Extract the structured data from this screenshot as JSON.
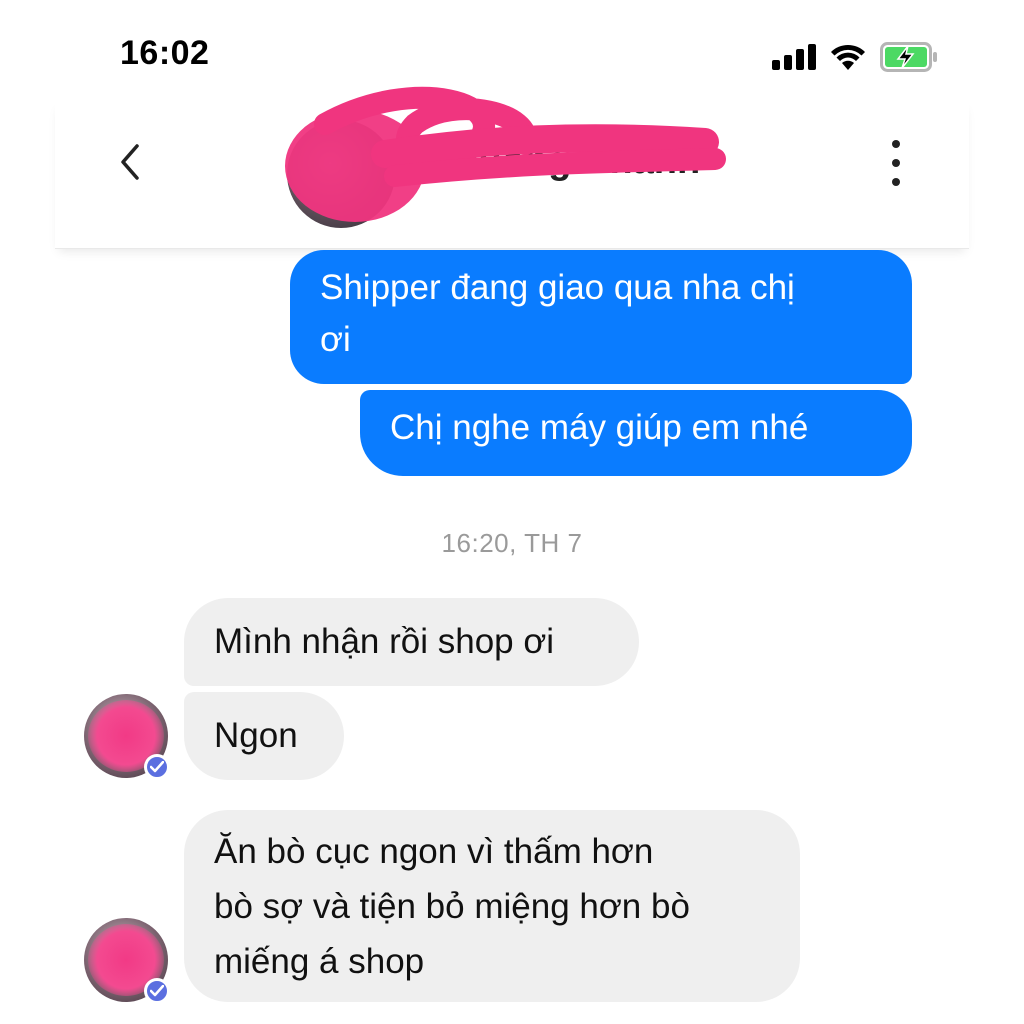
{
  "status_bar": {
    "time": "16:02",
    "icons": [
      "cellular-signal-icon",
      "wifi-icon",
      "battery-charging-icon"
    ],
    "battery_color": "#4cd964"
  },
  "header": {
    "contact_name": "Phuong Khanh",
    "back_icon": "chevron-left-icon",
    "more_icon": "more-vertical-icon",
    "redaction_color": "#f0357f"
  },
  "messages": {
    "outgoing": [
      {
        "text_line1": "Shipper đang giao qua nha chị",
        "text_line2": "ơi"
      },
      {
        "text": "Chị nghe máy giúp em nhé"
      }
    ],
    "timestamp": "16:20, TH 7",
    "incoming": [
      {
        "text": "Mình nhận rồi shop ơi"
      },
      {
        "text": "Ngon"
      },
      {
        "text_line1": "Ăn bò cục ngon vì thấm hơn",
        "text_line2": "bò sợ và tiện bỏ miệng hơn bò",
        "text_line3": "miếng á shop"
      }
    ],
    "outgoing_color": "#0a7cff",
    "incoming_color": "#efefef"
  }
}
